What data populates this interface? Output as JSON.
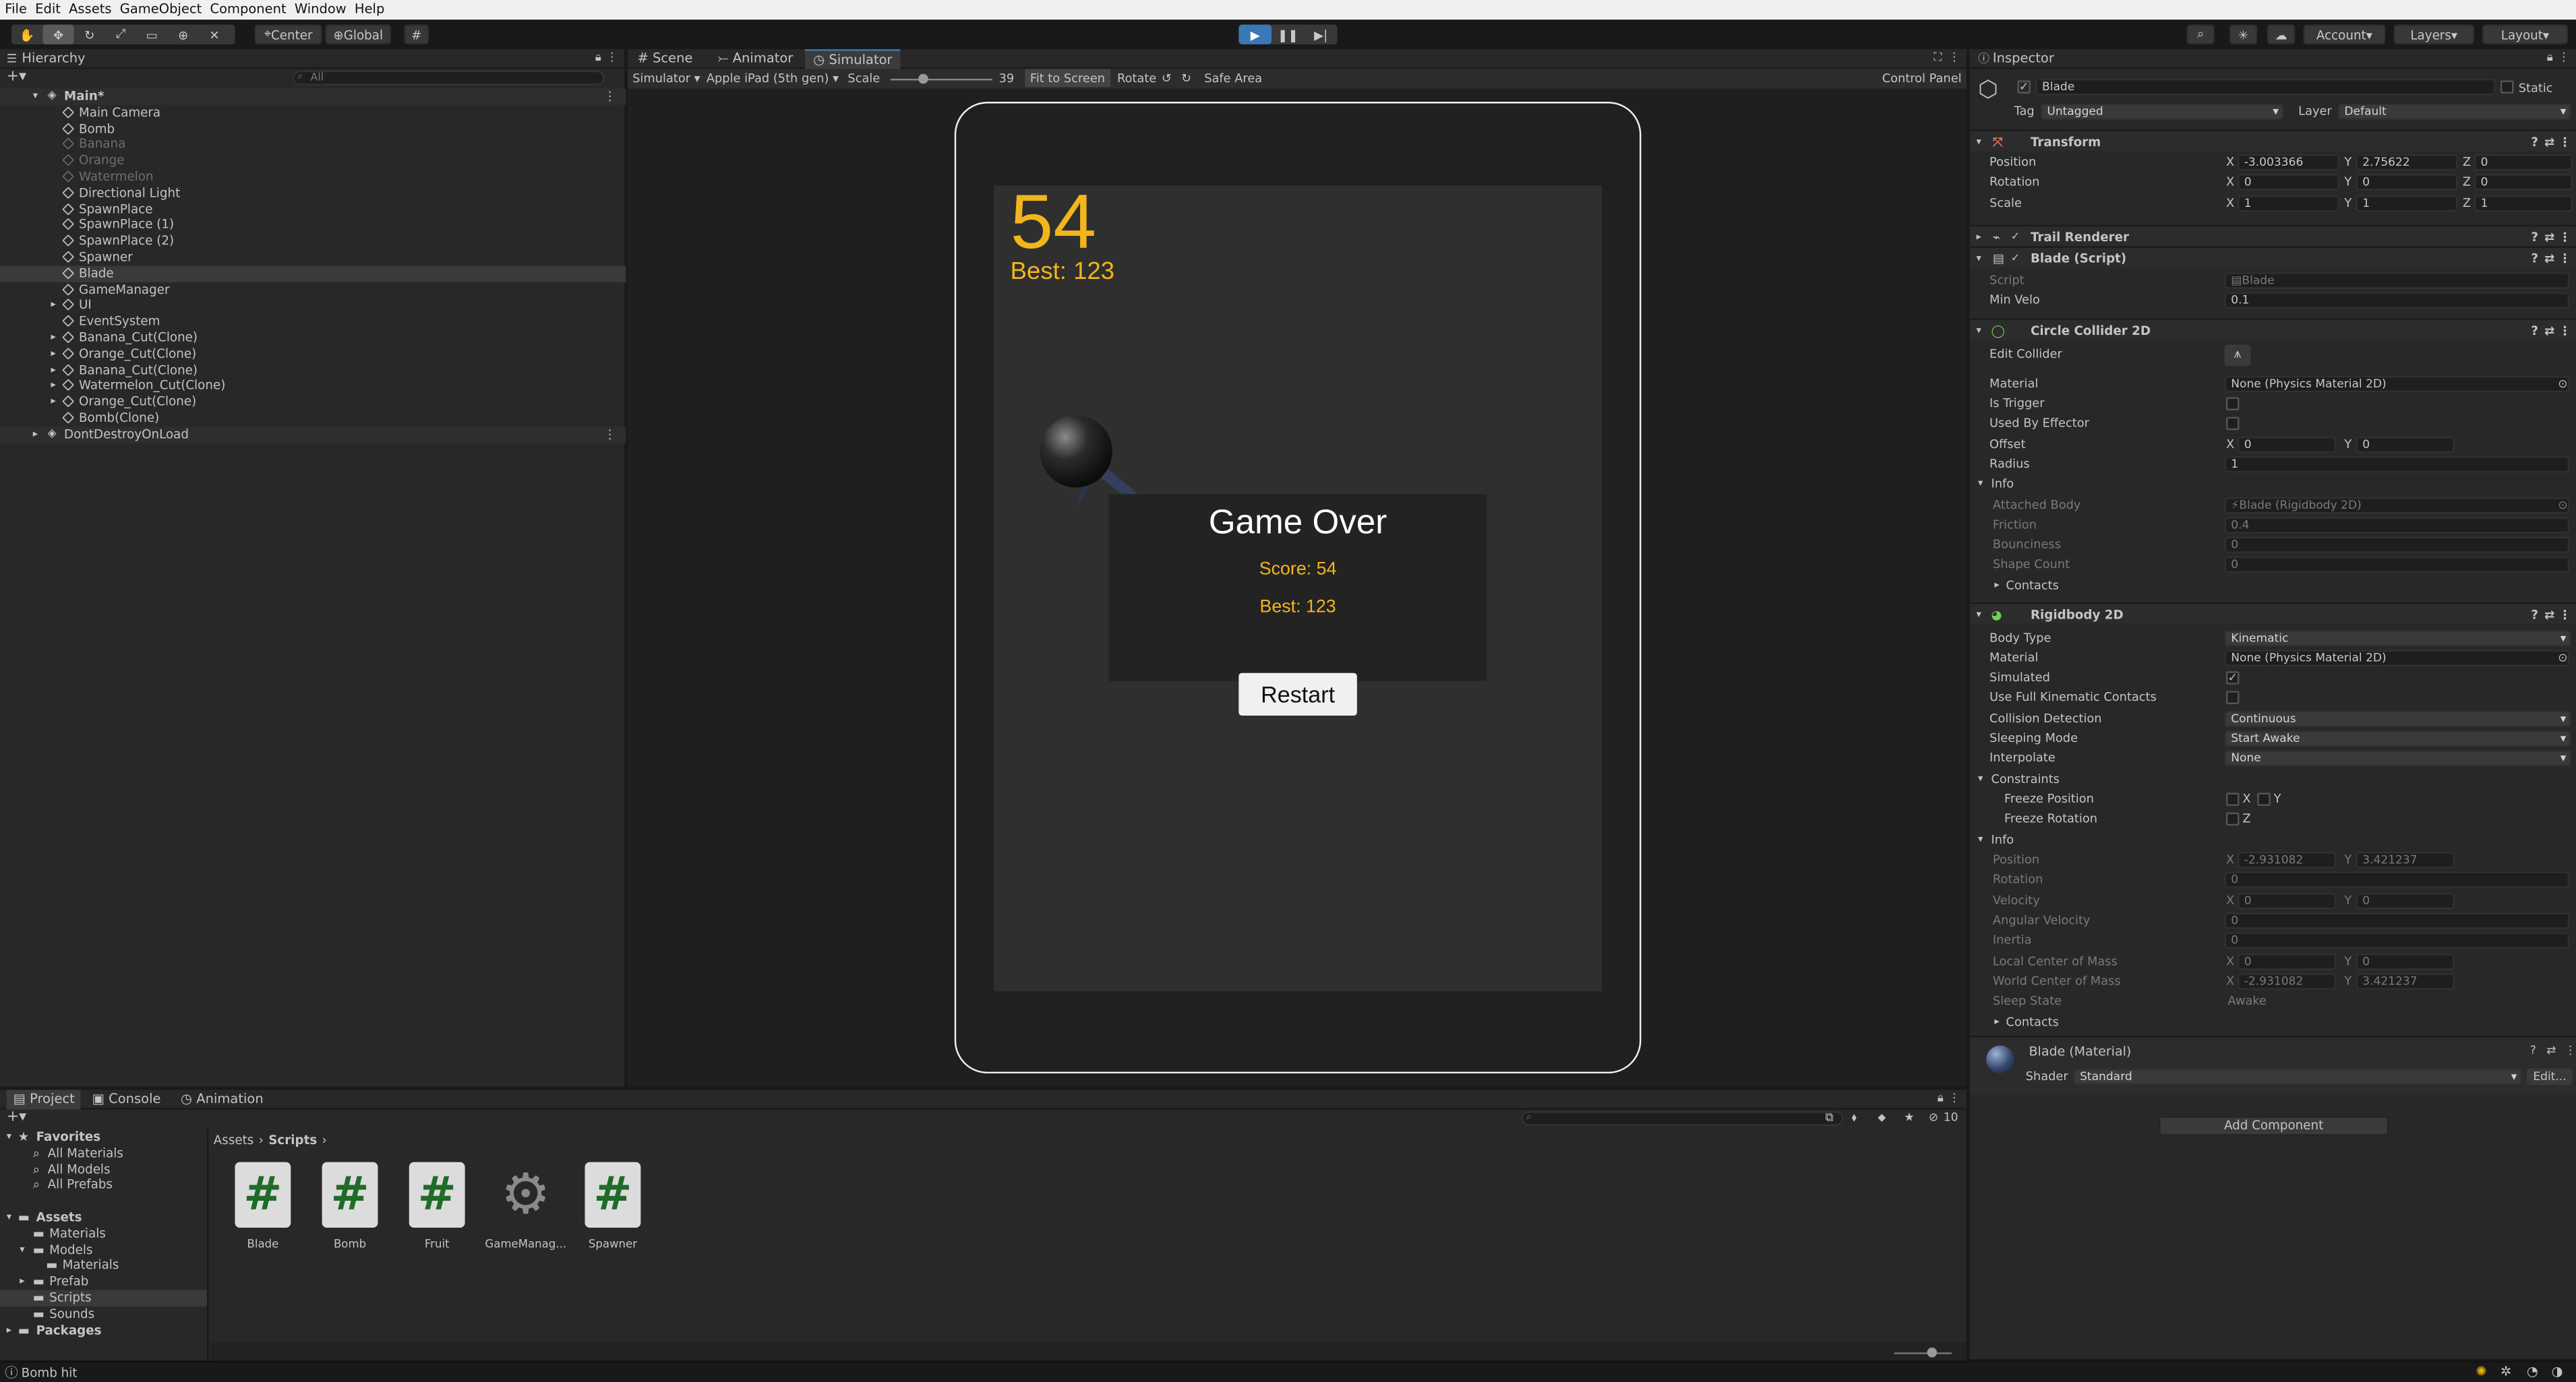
{
  "menubar": {
    "items": [
      "File",
      "Edit",
      "Assets",
      "GameObject",
      "Component",
      "Window",
      "Help"
    ]
  },
  "toolbar": {
    "pivot": "Center",
    "space": "Global",
    "account": "Account",
    "layers": "Layers",
    "layout": "Layout"
  },
  "hierarchy": {
    "title": "Hierarchy",
    "search_placeholder": "All",
    "scene": "Main*",
    "items": [
      {
        "label": "Main Camera",
        "dim": false
      },
      {
        "label": "Bomb",
        "dim": false
      },
      {
        "label": "Banana",
        "dim": true
      },
      {
        "label": "Orange",
        "dim": true
      },
      {
        "label": "Watermelon",
        "dim": true
      },
      {
        "label": "Directional Light",
        "dim": false
      },
      {
        "label": "SpawnPlace",
        "dim": false
      },
      {
        "label": "SpawnPlace (1)",
        "dim": false
      },
      {
        "label": "SpawnPlace (2)",
        "dim": false
      },
      {
        "label": "Spawner",
        "dim": false
      },
      {
        "label": "Blade",
        "dim": false
      },
      {
        "label": "GameManager",
        "dim": false
      },
      {
        "label": "UI",
        "dim": false
      },
      {
        "label": "EventSystem",
        "dim": false
      },
      {
        "label": "Banana_Cut(Clone)",
        "dim": false
      },
      {
        "label": "Orange_Cut(Clone)",
        "dim": false
      },
      {
        "label": "Banana_Cut(Clone)",
        "dim": false
      },
      {
        "label": "Watermelon_Cut(Clone)",
        "dim": false
      },
      {
        "label": "Orange_Cut(Clone)",
        "dim": false
      },
      {
        "label": "Bomb(Clone)",
        "dim": false
      }
    ],
    "dontdestroy": "DontDestroyOnLoad"
  },
  "views": {
    "tabs": [
      "Scene",
      "Animator",
      "Simulator"
    ]
  },
  "simtoolbar": {
    "mode": "Simulator",
    "device": "Apple iPad (5th gen)",
    "scale_label": "Scale",
    "scale_value": "39",
    "fit": "Fit to Screen",
    "rotate": "Rotate",
    "safe_area": "Safe Area",
    "control_panel": "Control Panel"
  },
  "game": {
    "score": "54",
    "best": "Best: 123",
    "over_title": "Game Over",
    "over_score": "Score: 54",
    "over_best": "Best: 123",
    "restart": "Restart"
  },
  "inspector": {
    "title": "Inspector",
    "object_name": "Blade",
    "static": "Static",
    "tag_label": "Tag",
    "tag": "Untagged",
    "layer_label": "Layer",
    "layer": "Default",
    "transform": {
      "title": "Transform",
      "position": "Position",
      "rotation": "Rotation",
      "scale": "Scale",
      "px": "-3.003366",
      "py": "2.75622",
      "pz": "0",
      "rx": "0",
      "ry": "0",
      "rz": "0",
      "sx": "1",
      "sy": "1",
      "sz": "1"
    },
    "trail": "Trail Renderer",
    "blade": {
      "title": "Blade (Script)",
      "script_label": "Script",
      "script": "Blade",
      "min_velo_label": "Min Velo",
      "min_velo": "0.1"
    },
    "circle": {
      "title": "Circle Collider 2D",
      "edit": "Edit Collider",
      "material_label": "Material",
      "material": "None (Physics Material 2D)",
      "trigger": "Is Trigger",
      "effector": "Used By Effector",
      "offset": "Offset",
      "ox": "0",
      "oy": "0",
      "radius_label": "Radius",
      "radius": "1",
      "info": "Info",
      "body_label": "Attached Body",
      "body": "Blade (Rigidbody 2D)",
      "friction_label": "Friction",
      "friction": "0.4",
      "bounciness_label": "Bounciness",
      "bounciness": "0",
      "shape_label": "Shape Count",
      "shape": "0",
      "contacts": "Contacts"
    },
    "rb": {
      "title": "Rigidbody 2D",
      "body_type_label": "Body Type",
      "body_type": "Kinematic",
      "material_label": "Material",
      "material": "None (Physics Material 2D)",
      "simulated": "Simulated",
      "kinematic": "Use Full Kinematic Contacts",
      "collision_label": "Collision Detection",
      "collision": "Continuous",
      "sleep_label": "Sleeping Mode",
      "sleep": "Start Awake",
      "interp_label": "Interpolate",
      "interp": "None",
      "constraints": "Constraints",
      "freeze_pos": "Freeze Position",
      "freeze_rot": "Freeze Rotation",
      "info": "Info",
      "pos_label": "Position",
      "pos_x": "-2.931082",
      "pos_y": "3.421237",
      "rot_label": "Rotation",
      "rot": "0",
      "vel_label": "Velocity",
      "vel_x": "0",
      "vel_y": "0",
      "ang_label": "Angular Velocity",
      "ang": "0",
      "inertia_label": "Inertia",
      "inertia": "0",
      "lcom_label": "Local Center of Mass",
      "lcom_x": "0",
      "lcom_y": "0",
      "wcom_label": "World Center of Mass",
      "wcom_x": "-2.931082",
      "wcom_y": "3.421237",
      "sleepstate_label": "Sleep State",
      "sleepstate": "Awake",
      "contacts": "Contacts"
    },
    "material": {
      "title": "Blade (Material)",
      "shader_label": "Shader",
      "shader": "Standard",
      "edit": "Edit..."
    },
    "add_component": "Add Component"
  },
  "project": {
    "tabs": [
      "Project",
      "Console",
      "Animation"
    ],
    "favorites": "Favorites",
    "fav_items": [
      "All Materials",
      "All Models",
      "All Prefabs"
    ],
    "assets": "Assets",
    "tree": [
      "Materials",
      "Models",
      "Materials",
      "Prefab",
      "Scripts",
      "Sounds"
    ],
    "packages": "Packages",
    "breadcrumb": [
      "Assets",
      "Scripts"
    ],
    "count": "10",
    "files": [
      {
        "name": "Blade",
        "type": "script"
      },
      {
        "name": "Bomb",
        "type": "script"
      },
      {
        "name": "Fruit",
        "type": "script"
      },
      {
        "name": "GameManag...",
        "type": "gear"
      },
      {
        "name": "Spawner",
        "type": "script"
      }
    ]
  },
  "status": {
    "message": "Bomb hit"
  },
  "colors": {
    "accent": "#f2b51c",
    "selection": "#2c5d87",
    "play": "#3a78b5"
  }
}
